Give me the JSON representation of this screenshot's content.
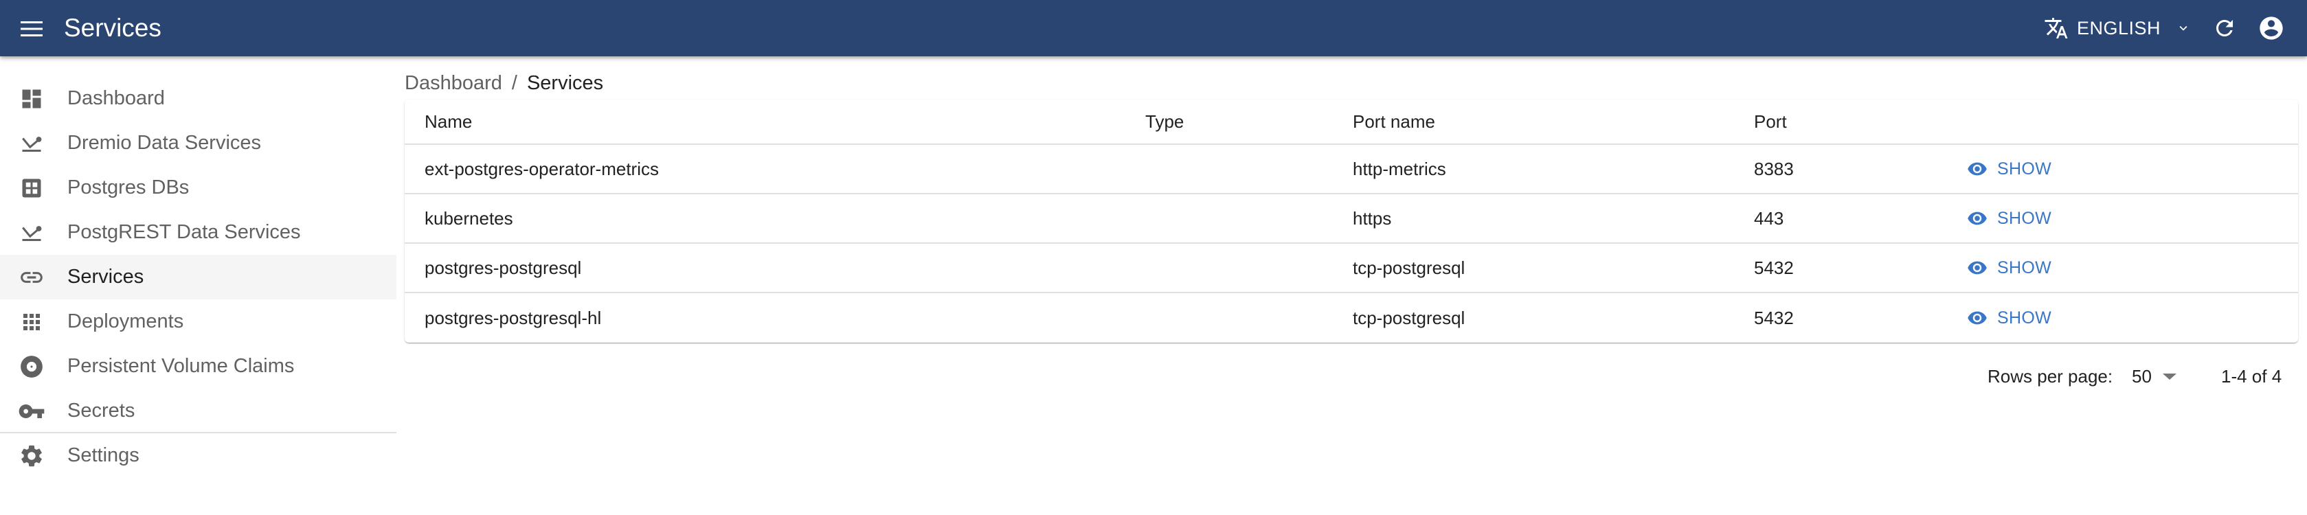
{
  "appbar": {
    "title": "Services",
    "language_label": "ENGLISH",
    "icons": {
      "menu": "menu-icon",
      "translate": "translate-icon",
      "chevron": "chevron-down-icon",
      "refresh": "refresh-icon",
      "account": "account-circle-icon"
    },
    "background_color": "#2a4571"
  },
  "sidebar": {
    "items": [
      {
        "label": "Dashboard",
        "icon": "dashboard-icon",
        "selected": false
      },
      {
        "label": "Dremio Data Services",
        "icon": "data-service-icon",
        "selected": false
      },
      {
        "label": "Postgres DBs",
        "icon": "grid-box-icon",
        "selected": false
      },
      {
        "label": "PostgREST Data Services",
        "icon": "data-service-icon",
        "selected": false
      },
      {
        "label": "Services",
        "icon": "link-icon",
        "selected": true
      },
      {
        "label": "Deployments",
        "icon": "apps-grid-icon",
        "selected": false
      },
      {
        "label": "Persistent Volume Claims",
        "icon": "disc-icon",
        "selected": false
      },
      {
        "label": "Secrets",
        "icon": "key-icon",
        "selected": false
      }
    ],
    "footer_items": [
      {
        "label": "Settings",
        "icon": "gear-icon",
        "selected": false
      }
    ]
  },
  "breadcrumb": {
    "items": [
      "Dashboard",
      "Services"
    ],
    "separator": "/"
  },
  "table": {
    "columns": [
      "Name",
      "Type",
      "Port name",
      "Port",
      ""
    ],
    "rows": [
      {
        "name": "ext-postgres-operator-metrics",
        "type": "",
        "port_name": "http-metrics",
        "port": "8383",
        "action": "SHOW"
      },
      {
        "name": "kubernetes",
        "type": "",
        "port_name": "https",
        "port": "443",
        "action": "SHOW"
      },
      {
        "name": "postgres-postgresql",
        "type": "",
        "port_name": "tcp-postgresql",
        "port": "5432",
        "action": "SHOW"
      },
      {
        "name": "postgres-postgresql-hl",
        "type": "",
        "port_name": "tcp-postgresql",
        "port": "5432",
        "action": "SHOW"
      }
    ],
    "action_color": "#3a76c7"
  },
  "pagination": {
    "rows_per_page_label": "Rows per page:",
    "rows_per_page_value": "50",
    "range_label": "1-4 of 4"
  }
}
